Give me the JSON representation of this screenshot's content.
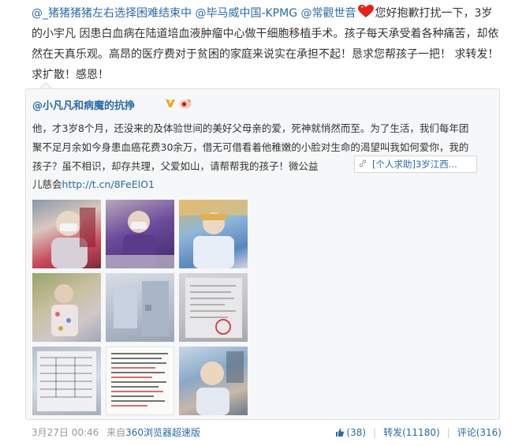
{
  "post": {
    "mentions": [
      "@_猪猪猪猪左右选择困难结束中",
      "@毕马威中国-KPMG",
      "@常觀世音"
    ],
    "body_text": "您好抱歉打扰一下，3岁的小宇凡 因患白血病在陆道培血液肿瘤中心做干细胞移植手术。孩子每天承受着各种痛苦，却依然在天真乐观。高昂的医疗费对于贫困的家庭来说实在承担不起！恳求您帮孩子一把！ 求转发！求扩散！感恩！"
  },
  "original": {
    "author": "@小凡凡和病魔的抗挣",
    "text": "他，才3岁8个月，还没来的及体验世间的美好父母亲的爱，死神就悄然而至。为了生活，我们每年团聚不足月余如今身患血癌花费30余万，借无可借看着他稚嫩的小脸对生命的渴望叫我如何爱你，我的孩子？虽不相识，却存共理，父爱如山，请帮帮我的孩子！微公益",
    "tag_label": "[个人求助]3岁江西...",
    "link_prefix": "儿慈会",
    "link_url": "http://t.cn/8FeElO1",
    "images": [
      "child-with-mask-photo",
      "child-in-purple-with-mask-photo",
      "child-in-hospital-bed-photo",
      "child-in-floral-pajamas-photo",
      "hospital-room-photo",
      "medical-document-photo",
      "medical-form-photo",
      "appeal-letter-image",
      "child-in-hospital-photo"
    ]
  },
  "meta": {
    "date": "3月27日 00:46",
    "source_prefix": "来自",
    "source": "360浏览器超速版"
  },
  "actions": {
    "like_count": "(38)",
    "repost_label": "转发",
    "repost_count": "(11180)",
    "comment_label": "评论",
    "comment_count": "(316)"
  },
  "colors": {
    "link": "#2b6aa6",
    "heart": "#e2231a",
    "muted": "#999999"
  }
}
